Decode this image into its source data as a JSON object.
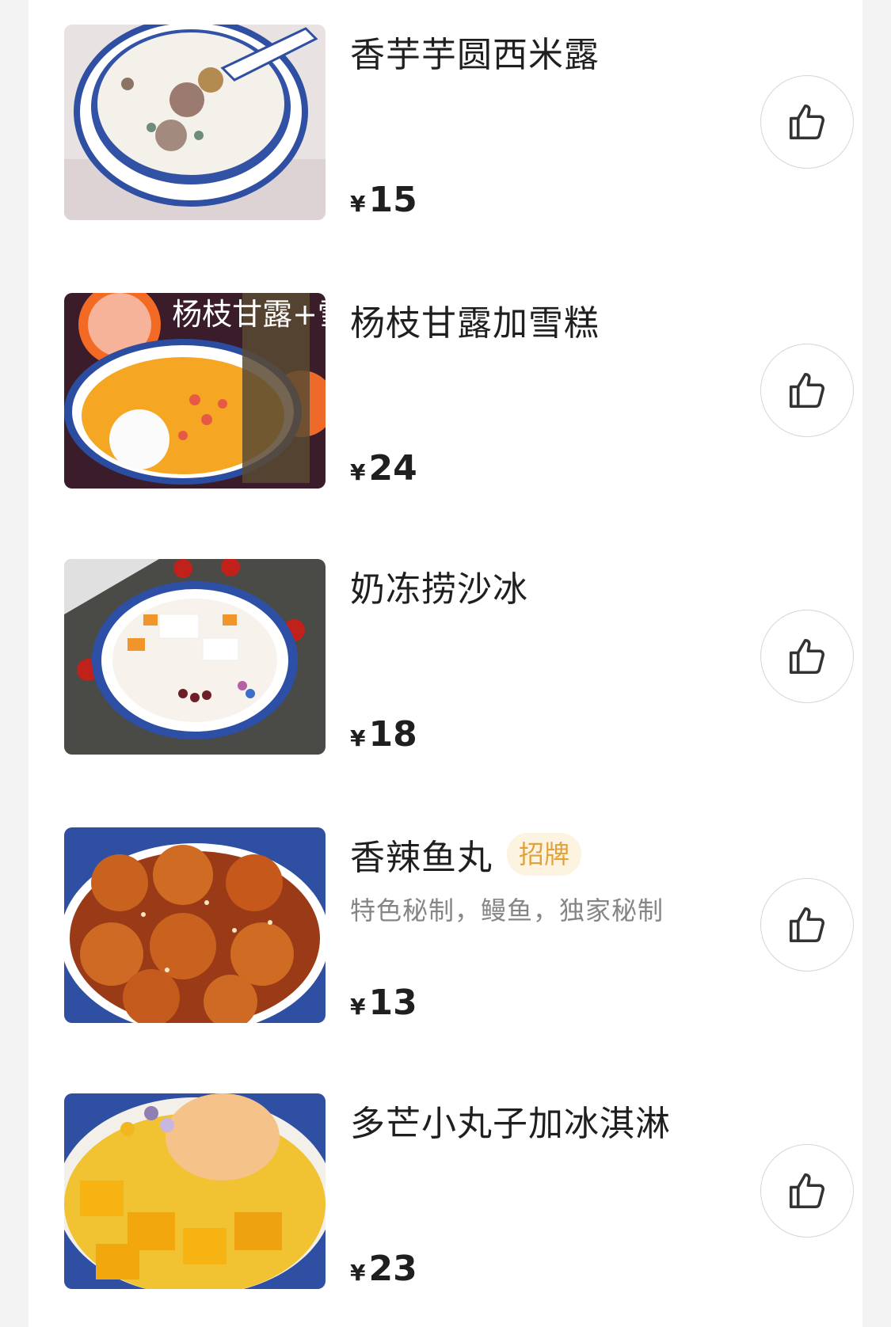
{
  "currency_symbol": "¥",
  "colors": {
    "badge_text": "#e0a23a",
    "badge_bg": "#fdf3e1",
    "title_text": "#1f1f1f",
    "desc_text": "#858585"
  },
  "items": [
    {
      "name": "香芋芋圆西米露",
      "price": "15",
      "image_icon": "taro-sago-dessert-photo",
      "like_icon": "thumbs-up-icon"
    },
    {
      "name": "杨枝甘露加雪糕",
      "price": "24",
      "image_icon": "mango-pomelo-ice-cream-photo",
      "image_text": "杨枝甘露+雪糕",
      "like_icon": "thumbs-up-icon"
    },
    {
      "name": "奶冻捞沙冰",
      "price": "18",
      "image_icon": "milk-jelly-shaved-ice-photo",
      "like_icon": "thumbs-up-icon"
    },
    {
      "name": "香辣鱼丸",
      "badge": "招牌",
      "desc": "特色秘制，鳗鱼，独家秘制",
      "price": "13",
      "image_icon": "spicy-fish-balls-photo",
      "like_icon": "thumbs-up-icon"
    },
    {
      "name": "多芒小丸子加冰淇淋",
      "price": "23",
      "image_icon": "mango-balls-ice-cream-photo",
      "like_icon": "thumbs-up-icon"
    }
  ]
}
